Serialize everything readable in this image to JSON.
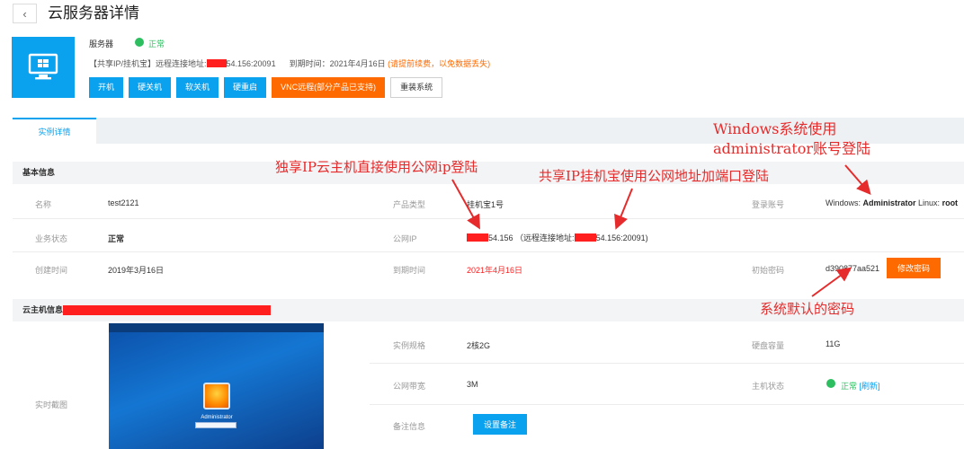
{
  "header": {
    "back_icon": "chevron-left-icon",
    "title": "云服务器详情"
  },
  "server": {
    "icon": "windows-monitor-icon",
    "name": "服务器",
    "status": "正常",
    "status_color": "#2dbe60",
    "subline_prefix": "【共享IP/挂机宝】远程连接地址:",
    "subline_addr": "54.156:20091",
    "expire_label": "到期时间：2021年4月16日",
    "expire_warn": "(请提前续费，以免数据丢失)"
  },
  "actions": {
    "start": "开机",
    "hard_off": "硬关机",
    "soft_off": "软关机",
    "hard_restart": "硬重启",
    "vnc": "VNC远程(部分产品已支持)",
    "reinstall": "重装系统"
  },
  "tabs": {
    "instance_detail": "实例详情"
  },
  "basic": {
    "section_title": "基本信息",
    "name_label": "名称",
    "name_value": "test2121",
    "biz_status_label": "业务状态",
    "biz_status_value": "正常",
    "created_label": "创建时间",
    "created_value": "2019年3月16日",
    "product_type_label": "产品类型",
    "product_type_value": "挂机宝1号",
    "public_ip_label": "公网IP",
    "public_ip_value": "54.156",
    "public_ip_note_prefix": "（远程连接地址:",
    "public_ip_note_addr": "54.156:20091)",
    "expire_label": "到期时间",
    "expire_value": "2021年4月16日",
    "login_label": "登录账号",
    "login_win_prefix": "Windows: ",
    "login_win_user": "Administrator",
    "login_linux_prefix": " Linux: ",
    "login_linux_user": "root",
    "initpwd_label": "初始密码",
    "initpwd_value": "d390877aa521",
    "change_pwd_button": "修改密码"
  },
  "host": {
    "section_title": "云主机信息",
    "screenshot_label": "实时截图",
    "screenshot_user": "Administrator",
    "spec_label": "实例规格",
    "spec_value": "2核2G",
    "disk_label": "硬盘容量",
    "disk_value": "11G",
    "bandwidth_label": "公网带宽",
    "bandwidth_value": "3M",
    "host_status_label": "主机状态",
    "host_status_value": "正常",
    "refresh_link": "[刷新]",
    "remark_label": "备注信息",
    "remark_button": "设置备注"
  },
  "annotations": {
    "dedicated_ip": "独享IP云主机直接使用公网ip登陆",
    "shared_ip": "共享IP挂机宝使用公网地址加端口登陆",
    "windows_line1": "Windows系统使用",
    "windows_line2": "administrator账号登陆",
    "default_pwd": "系统默认的密码",
    "color": "#e52b2b"
  },
  "colors": {
    "primary": "#0aa1ee",
    "orange": "#ff6a00",
    "red": "#ff1f1f",
    "green": "#2dbe60"
  }
}
